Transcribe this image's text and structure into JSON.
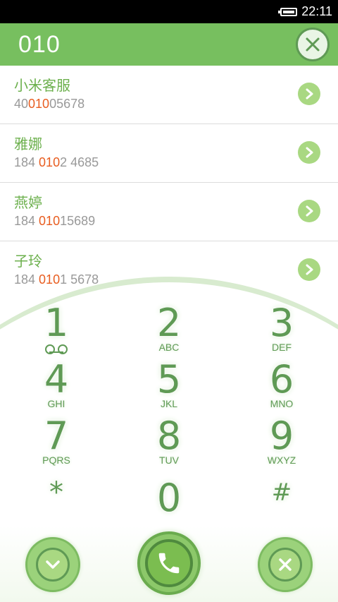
{
  "status_bar": {
    "time": "22:11"
  },
  "header": {
    "dialed_number": "010"
  },
  "contacts": [
    {
      "name": "小米客服",
      "phone_pre": "40",
      "phone_match": "010",
      "phone_post": "05678"
    },
    {
      "name": "雅娜",
      "phone_pre": "184 ",
      "phone_match": "010",
      "phone_post": "2 4685"
    },
    {
      "name": "燕婷",
      "phone_pre": "184 ",
      "phone_match": "010",
      "phone_post": "15689"
    },
    {
      "name": "子玲",
      "phone_pre": "184 ",
      "phone_match": "010",
      "phone_post": "1 5678"
    }
  ],
  "keypad": [
    {
      "digit": "1",
      "letters": ""
    },
    {
      "digit": "2",
      "letters": "ABC"
    },
    {
      "digit": "3",
      "letters": "DEF"
    },
    {
      "digit": "4",
      "letters": "GHI"
    },
    {
      "digit": "5",
      "letters": "JKL"
    },
    {
      "digit": "6",
      "letters": "MNO"
    },
    {
      "digit": "7",
      "letters": "PQRS"
    },
    {
      "digit": "8",
      "letters": "TUV"
    },
    {
      "digit": "9",
      "letters": "WXYZ"
    },
    {
      "digit": "*",
      "letters": ""
    },
    {
      "digit": "0",
      "letters": ""
    },
    {
      "digit": "#",
      "letters": ""
    }
  ],
  "colors": {
    "accent": "#77bf5f",
    "highlight": "#e85d20",
    "key_text": "#5f9a55"
  },
  "icons": {
    "clear": "close-icon",
    "contact_arrow": "chevron-right-icon",
    "collapse": "chevron-down-icon",
    "call": "phone-icon",
    "delete": "close-icon",
    "voicemail": "voicemail-icon"
  }
}
